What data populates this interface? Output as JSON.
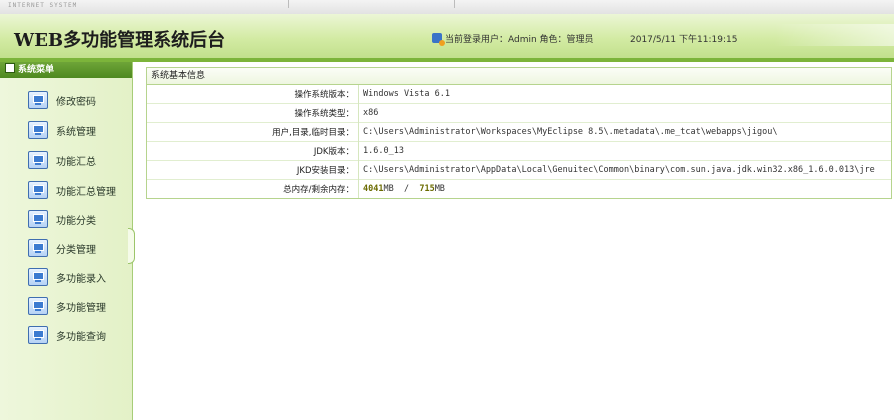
{
  "top_tag": "INTERNET SYSTEM",
  "header": {
    "title": "WEB多功能管理系统后台",
    "user_info": "当前登录用户：Admin 角色：管理员",
    "datetime": "2017/5/11 下午11:19:15"
  },
  "sidebar": {
    "title": "系统菜单",
    "items": [
      {
        "label": "修改密码"
      },
      {
        "label": "系统管理"
      },
      {
        "label": "功能汇总"
      },
      {
        "label": "功能汇总管理"
      },
      {
        "label": "功能分类"
      },
      {
        "label": "分类管理"
      },
      {
        "label": "多功能录入"
      },
      {
        "label": "多功能管理"
      },
      {
        "label": "多功能查询"
      }
    ]
  },
  "panel": {
    "title": "系统基本信息",
    "rows": [
      {
        "label": "操作系统版本：",
        "value": "Windows Vista  6.1"
      },
      {
        "label": "操作系统类型：",
        "value": "x86"
      },
      {
        "label": "用户,目录,临时目录：",
        "value": "C:\\Users\\Administrator\\Workspaces\\MyEclipse 8.5\\.metadata\\.me_tcat\\webapps\\jigou\\"
      },
      {
        "label": "JDK版本：",
        "value": "1.6.0_13"
      },
      {
        "label": "JKD安装目录：",
        "value": "C:\\Users\\Administrator\\AppData\\Local\\Genuitec\\Common\\binary\\com.sun.java.jdk.win32.x86_1.6.0.013\\jre"
      },
      {
        "label": "总内存/剩余内存：",
        "value_total": "4041",
        "value_total_unit": "MB",
        "value_sep": "  /  ",
        "value_free": "715",
        "value_free_unit": "MB"
      }
    ]
  },
  "colors": {
    "header_bottom_border": "#7cb43a",
    "sidebar_head": "#5a9a2a",
    "panel_border": "#b6d48e",
    "memory_number": "#6b6b00"
  },
  "icons": {
    "user": "user-icon",
    "sidebar_head": "menu-icon",
    "menu_item": "app-window-icon"
  }
}
